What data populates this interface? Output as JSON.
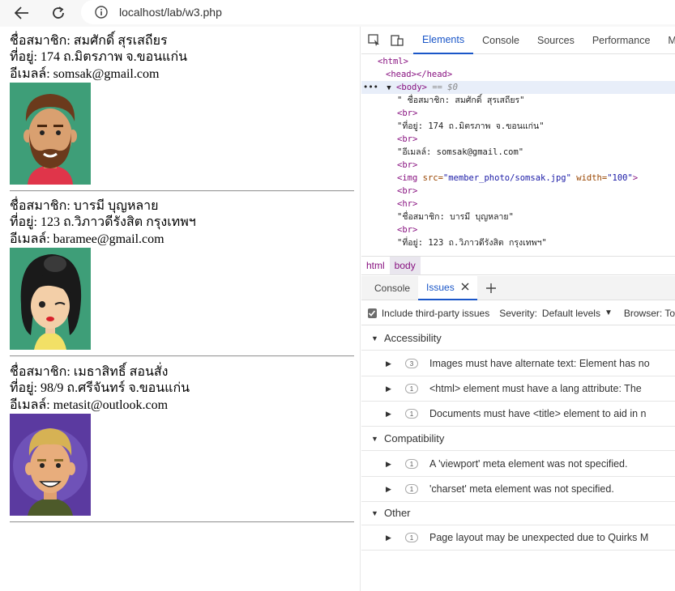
{
  "browser": {
    "url": "localhost/lab/w3.php",
    "icons": {
      "back": "back-arrow-icon",
      "reload": "reload-icon",
      "info": "info-icon"
    }
  },
  "members": [
    {
      "name": "ชื่อสมาชิก: สมศักดิ์ สุรเสถียร",
      "address": "ที่อยู่: 174 ถ.มิตรภาพ จ.ขอนแก่น",
      "email": "อีเมลล์: somsak@gmail.com",
      "photo_icon": "bearded-man-avatar"
    },
    {
      "name": "ชื่อสมาชิก: บารมี บุญหลาย",
      "address": "ที่อยู่: 123 ถ.วิภาวดีรังสิต กรุงเทพฯ",
      "email": "อีเมลล์: baramee@gmail.com",
      "photo_icon": "woman-avatar"
    },
    {
      "name": "ชื่อสมาชิก: เมธาสิทธิ์ สอนสั่ง",
      "address": "ที่อยู่: 98/9 ถ.ศรีจันทร์ จ.ขอนแก่น",
      "email": "อีเมลล์: metasit@outlook.com",
      "photo_icon": "blond-man-avatar"
    }
  ],
  "devtools": {
    "tabs": [
      "Elements",
      "Console",
      "Sources",
      "Performance",
      "Me"
    ],
    "active_tab": "Elements",
    "dom_lines": [
      {
        "tag_open": "<html>"
      },
      {
        "tag_open": "<head></head>"
      },
      {
        "body": "<body>",
        "eq": "== $0"
      },
      {
        "text": "\" ชื่อสมาชิก: สมศักดิ์ สุรเสถียร\""
      },
      {
        "tag_open": "<br>"
      },
      {
        "text": "\"ที่อยู่: 174 ถ.มิตรภาพ จ.ขอนแก่น\""
      },
      {
        "tag_open": "<br>"
      },
      {
        "text": "\"อีเมลล์: somsak@gmail.com\""
      },
      {
        "tag_open": "<br>"
      },
      {
        "img_tag": "<img",
        "src_attr": " src=",
        "src_val": "\"member_photo/somsak.jpg\"",
        "w_attr": " width=",
        "w_val": "\"100\"",
        "close": ">"
      },
      {
        "tag_open": "<br>"
      },
      {
        "tag_open": "<hr>"
      },
      {
        "text": "\"ชื่อสมาชิก: บารมี บุญหลาย\""
      },
      {
        "tag_open": "<br>"
      },
      {
        "text": "\"ที่อยู่: 123 ถ.วิภาวดีรังสิต กรุงเทพฯ\""
      }
    ],
    "breadcrumbs": [
      "html",
      "body"
    ],
    "drawer_tabs": [
      "Console",
      "Issues"
    ],
    "active_drawer_tab": "Issues",
    "filter": {
      "third_party_label": "Include third-party issues",
      "severity_label": "Severity:",
      "severity_value": "Default levels",
      "browser_label": "Browser: To"
    },
    "issue_groups": [
      {
        "title": "Accessibility",
        "issues": [
          {
            "count": "3",
            "text": "Images must have alternate text: Element has no"
          },
          {
            "count": "1",
            "text": "<html> element must have a lang attribute: The"
          },
          {
            "count": "1",
            "text": "Documents must have <title> element to aid in n"
          }
        ]
      },
      {
        "title": "Compatibility",
        "issues": [
          {
            "count": "1",
            "text": "A 'viewport' meta element was not specified."
          },
          {
            "count": "1",
            "text": "'charset' meta element was not specified."
          }
        ]
      },
      {
        "title": "Other",
        "issues": [
          {
            "count": "1",
            "text": "Page layout may be unexpected due to Quirks M"
          }
        ]
      }
    ]
  }
}
